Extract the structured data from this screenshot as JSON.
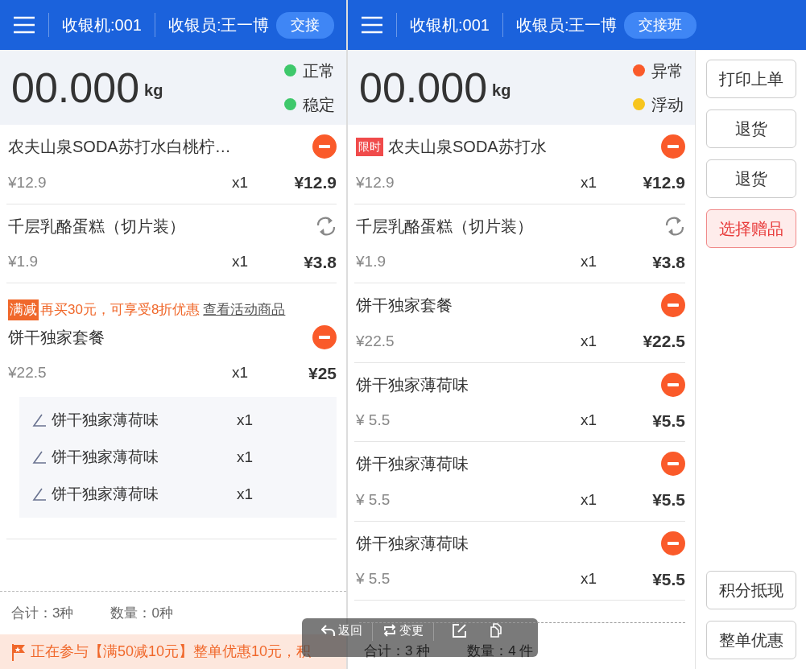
{
  "panes": [
    {
      "header": {
        "machine": "收银机:001",
        "cashier": "收银员:王一博",
        "handover_button": "交接"
      },
      "scale": {
        "weight": "00.000",
        "unit": "kg",
        "statuses": [
          {
            "label": "正常",
            "color": "#3ec86b"
          },
          {
            "label": "稳定",
            "color": "#3ec86b"
          }
        ]
      },
      "items": [
        {
          "name": "农夫山泉SODA苏打水白桃柠…",
          "kind": "remove",
          "unit_price": "¥12.9",
          "qty": "x1",
          "total": "¥12.9"
        },
        {
          "name": "千层乳酪蛋糕（切片装）",
          "kind": "refresh",
          "unit_price": "¥1.9",
          "qty": "x1",
          "total": "¥3.8"
        },
        {
          "promo": {
            "tag": "满减",
            "text": "再买30元，可享受8折优惠",
            "link": "查看活动商品"
          },
          "name": "饼干独家套餐",
          "kind": "remove",
          "unit_price": "¥22.5",
          "qty": "x1",
          "total": "¥25",
          "children": [
            {
              "name": "饼干独家薄荷味",
              "qty": "x1"
            },
            {
              "name": "饼干独家薄荷味",
              "qty": "x1"
            },
            {
              "name": "饼干独家薄荷味",
              "qty": "x1"
            }
          ]
        }
      ],
      "summary": {
        "kinds": "合计：3种",
        "quantity": "数量：0种"
      },
      "banner": "正在参与【满50减10元】整单优惠10元，积"
    },
    {
      "header": {
        "machine": "收银机:001",
        "cashier": "收银员:王一博",
        "handover_button": "交接班"
      },
      "scale": {
        "weight": "00.000",
        "unit": "kg",
        "statuses": [
          {
            "label": "异常",
            "color": "#fa5a2a"
          },
          {
            "label": "浮动",
            "color": "#f7c51e"
          }
        ]
      },
      "items": [
        {
          "tag": "限时",
          "name": "农夫山泉SODA苏打水",
          "kind": "remove",
          "unit_price": "¥12.9",
          "qty": "x1",
          "total": "¥12.9"
        },
        {
          "name": "千层乳酪蛋糕（切片装）",
          "kind": "refresh",
          "unit_price": "¥1.9",
          "qty": "x1",
          "total": "¥3.8"
        },
        {
          "name": "饼干独家套餐",
          "kind": "remove",
          "unit_price": "¥22.5",
          "qty": "x1",
          "total": "¥22.5"
        },
        {
          "name": "饼干独家薄荷味",
          "kind": "remove",
          "unit_price": "¥ 5.5",
          "qty": "x1",
          "total": "¥5.5"
        },
        {
          "name": "饼干独家薄荷味",
          "kind": "remove",
          "unit_price": "¥ 5.5",
          "qty": "x1",
          "total": "¥5.5"
        },
        {
          "name": "饼干独家薄荷味",
          "kind": "remove",
          "unit_price": "¥ 5.5",
          "qty": "x1",
          "total": "¥5.5"
        }
      ],
      "summary": {
        "kinds": "合计：3 种",
        "quantity": "数量：4 件"
      },
      "side_buttons_top": [
        {
          "label": "打印上单",
          "highlighted": false
        },
        {
          "label": "退货",
          "highlighted": false
        },
        {
          "label": "退货",
          "highlighted": false
        },
        {
          "label": "选择赠品",
          "highlighted": true
        }
      ],
      "side_buttons_bottom": [
        {
          "label": "积分抵现",
          "highlighted": false
        },
        {
          "label": "整单优惠",
          "highlighted": false
        }
      ]
    }
  ],
  "toolbar": [
    {
      "kind": "back",
      "label": "返回"
    },
    {
      "kind": "change",
      "label": "变更"
    },
    {
      "kind": "edit"
    },
    {
      "kind": "copy"
    }
  ]
}
